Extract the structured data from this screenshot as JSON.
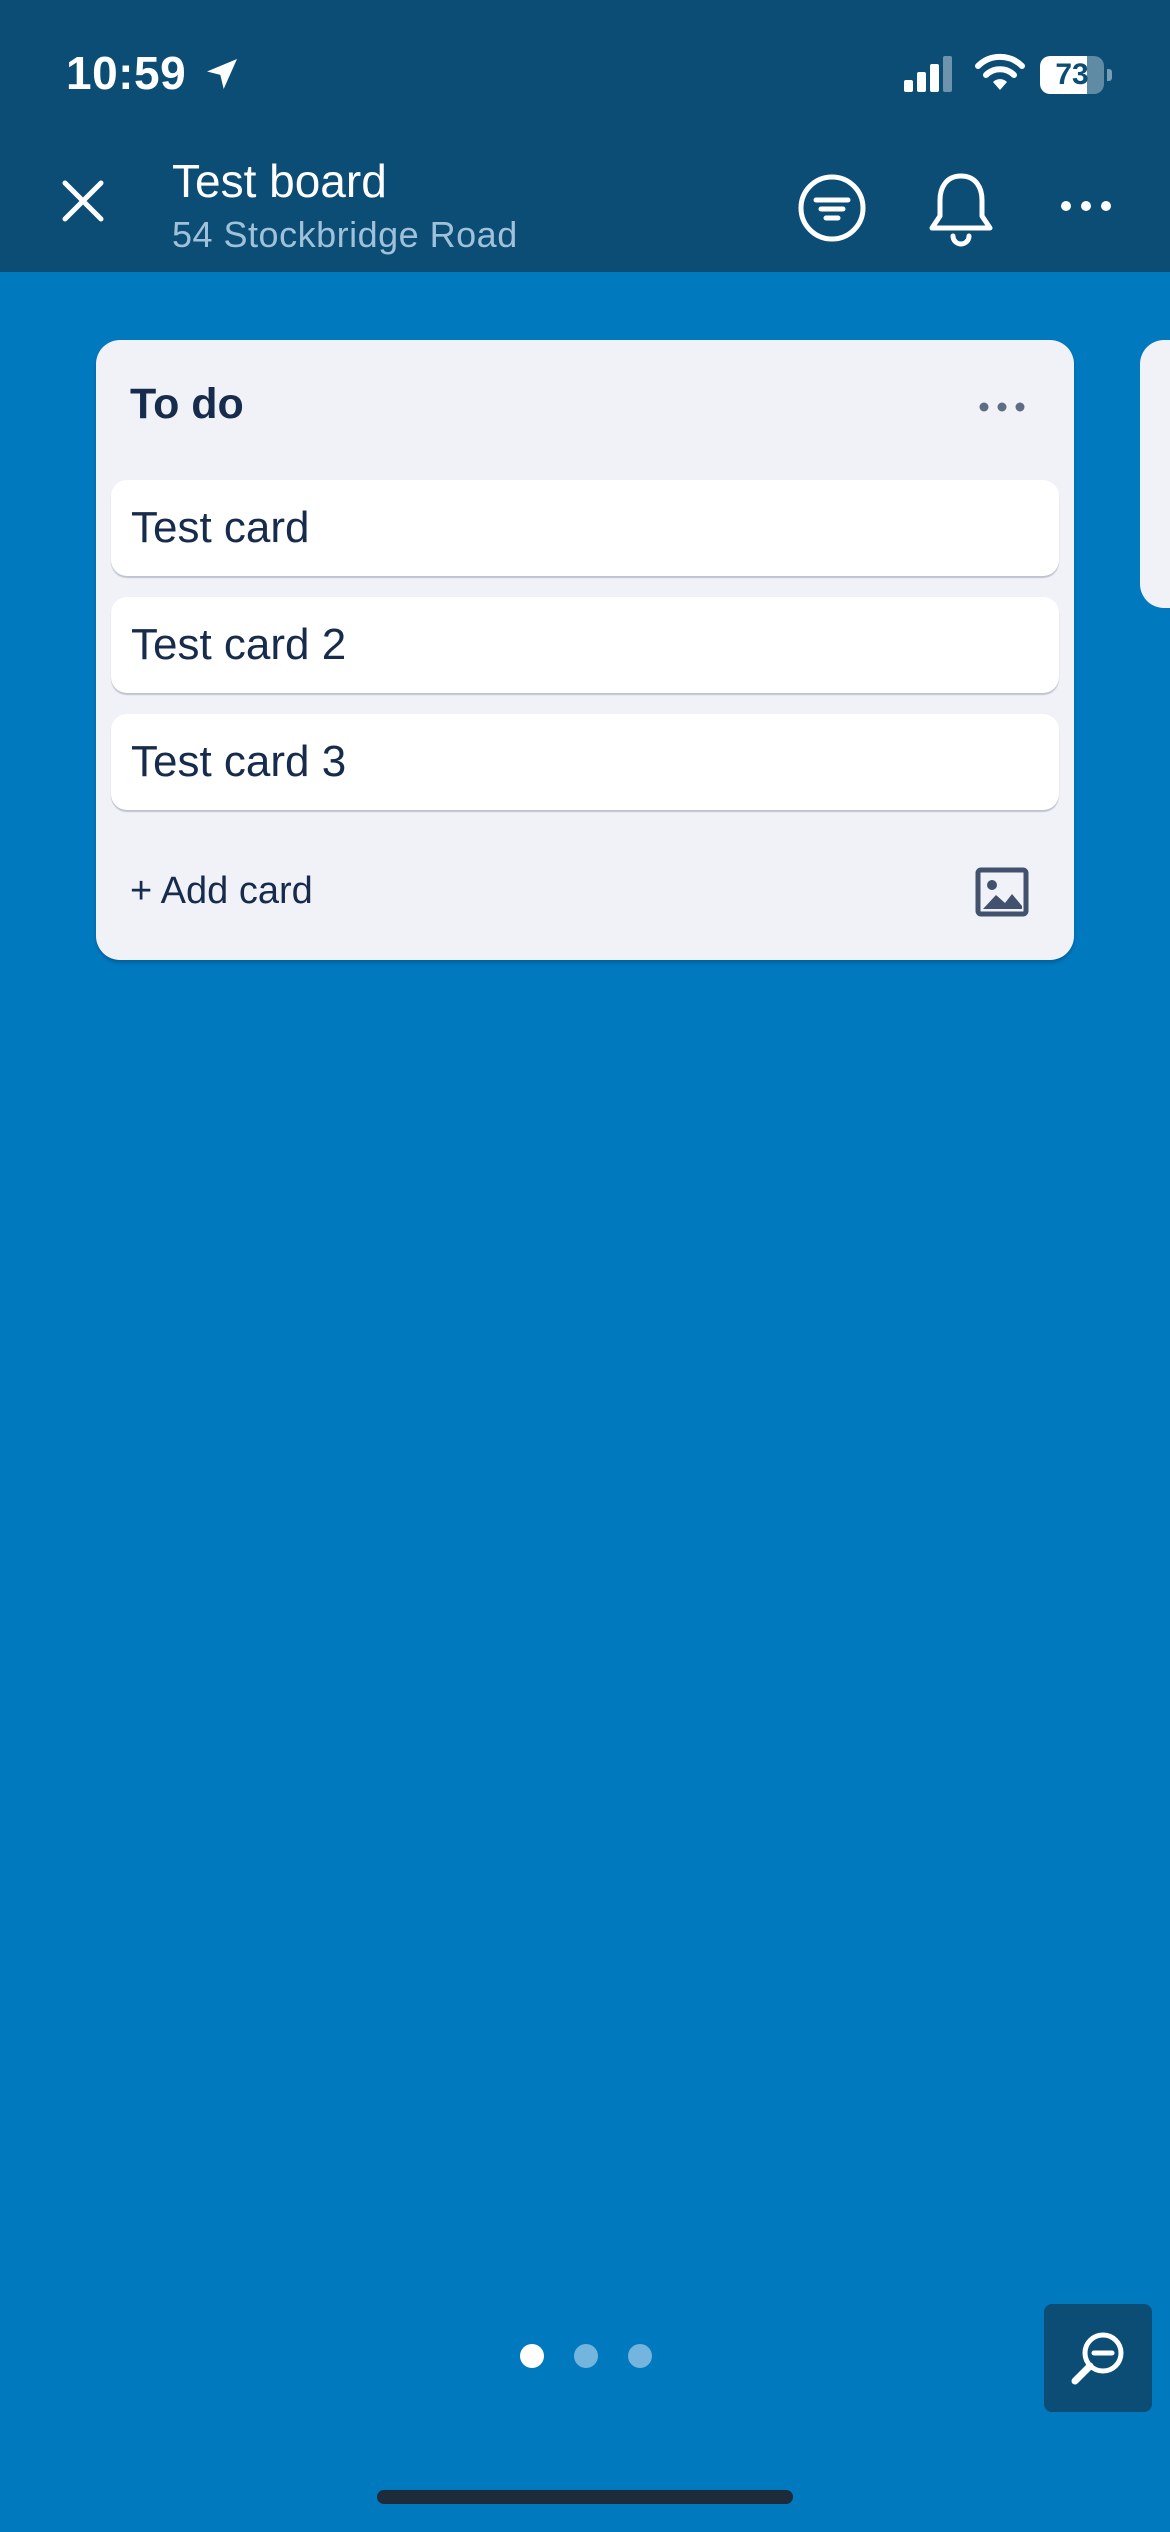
{
  "status_bar": {
    "time": "10:59",
    "battery_level": "73",
    "battery_fraction": 0.73,
    "location_icon": "location-arrow-icon",
    "signal_icon": "cellular-signal-icon",
    "wifi_icon": "wifi-icon"
  },
  "header": {
    "board_title": "Test board",
    "workspace_name": "54 Stockbridge Road",
    "close_icon": "close-icon",
    "filter_icon": "filter-icon",
    "bell_icon": "bell-icon",
    "more_icon": "more-icon"
  },
  "list": {
    "title": "To do",
    "cards": [
      {
        "title": "Test card"
      },
      {
        "title": "Test card 2"
      },
      {
        "title": "Test card 3"
      }
    ],
    "add_card_label": "+ Add card",
    "image_icon": "image-icon"
  },
  "pagination": {
    "page_count": 3,
    "current_page": 1
  },
  "colors": {
    "board_background": "#0079BF",
    "header_background": "#0C4D75",
    "list_background": "#F1F2F7",
    "text_primary": "#172B4D"
  },
  "zoom_icon": "zoom-out-icon"
}
